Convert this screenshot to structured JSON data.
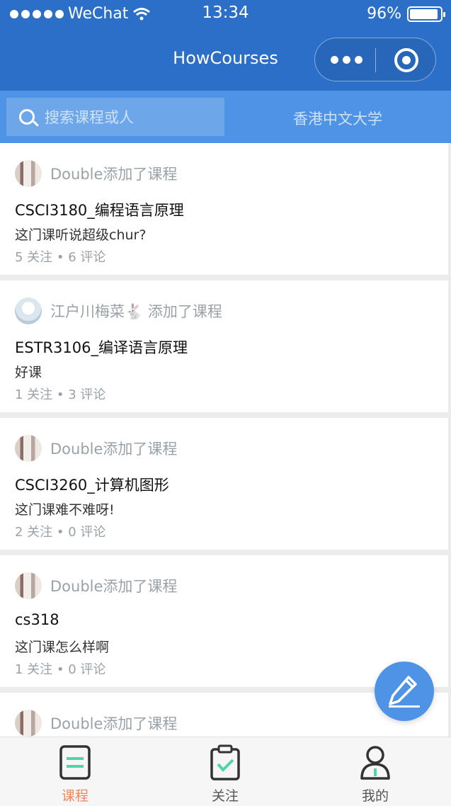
{
  "status_bar": {
    "carrier": "WeChat",
    "time": "13:34",
    "battery": "96%",
    "battery_level": 0.96
  },
  "nav": {
    "title": "HowCourses"
  },
  "search": {
    "placeholder": "搜索课程或人",
    "school": "香港中文大学"
  },
  "feed": [
    {
      "author": "Double添加了课程",
      "course": "CSCI3180_编程语言原理",
      "desc": "这门课听说超级chur?",
      "meta": "5 关注 • 6 评论"
    },
    {
      "author": "江户川梅菜🐇 添加了课程",
      "course": "ESTR3106_编译语言原理",
      "desc": "好课",
      "meta": "1 关注 • 3 评论"
    },
    {
      "author": "Double添加了课程",
      "course": "CSCI3260_计算机图形",
      "desc": "这门课难不难呀!",
      "meta": "2 关注 • 0 评论"
    },
    {
      "author": "Double添加了课程",
      "course": "cs318",
      "desc": "这门课怎么样啊",
      "meta": "1 关注 • 0 评论"
    },
    {
      "author": "Double添加了课程",
      "course": "",
      "desc": "",
      "meta": ""
    }
  ],
  "tabs": [
    {
      "label": "课程",
      "icon": "document-icon",
      "active": true
    },
    {
      "label": "关注",
      "icon": "clipboard-check-icon",
      "active": false
    },
    {
      "label": "我的",
      "icon": "person-icon",
      "active": false
    }
  ],
  "colors": {
    "primary": "#2b6fc9",
    "search_bg": "#4f93e6",
    "active_tab": "#f0875a",
    "accent_green": "#4fd6a6"
  }
}
